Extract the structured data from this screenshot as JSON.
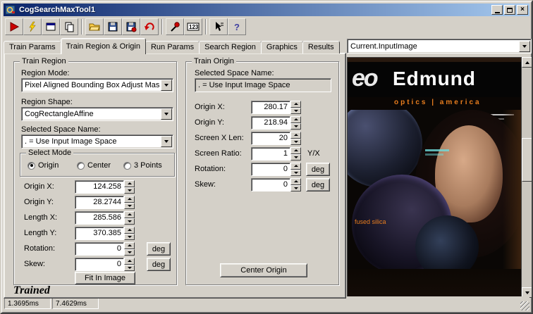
{
  "window": {
    "title": "CogSearchMaxTool1"
  },
  "toolbar": {
    "buttons": [
      {
        "name": "run",
        "icon": "run-icon"
      },
      {
        "name": "auto-run",
        "icon": "lightning-icon"
      },
      {
        "name": "tool-window",
        "icon": "window-icon"
      },
      {
        "name": "copy-window",
        "icon": "copy-icon"
      },
      {
        "name": "open-file",
        "icon": "open-folder-icon"
      },
      {
        "name": "save-file",
        "icon": "save-icon"
      },
      {
        "name": "save-image",
        "icon": "save-image-icon"
      },
      {
        "name": "reset",
        "icon": "undo-icon"
      },
      {
        "name": "probe",
        "icon": "probe-icon"
      },
      {
        "name": "numeric-display",
        "icon": "numeric-123-icon"
      },
      {
        "name": "pointer-info",
        "icon": "pointer-icon"
      },
      {
        "name": "help",
        "icon": "help-icon"
      }
    ]
  },
  "tabs": {
    "active_index": 1,
    "items": [
      {
        "label": "Train Params"
      },
      {
        "label": "Train Region & Origin"
      },
      {
        "label": "Run Params"
      },
      {
        "label": "Search Region"
      },
      {
        "label": "Graphics"
      },
      {
        "label": "Results"
      }
    ]
  },
  "image_selector": {
    "value": "Current.InputImage"
  },
  "train_region": {
    "title": "Train Region",
    "region_mode_label": "Region Mode:",
    "region_mode_value": "Pixel Aligned Bounding Box Adjust Mask",
    "region_shape_label": "Region Shape:",
    "region_shape_value": "CogRectangleAffine",
    "space_label": "Selected Space Name:",
    "space_value": ". = Use Input Image Space",
    "select_mode": {
      "title": "Select Mode",
      "options": [
        {
          "label": "Origin",
          "selected": true
        },
        {
          "label": "Center",
          "selected": false
        },
        {
          "label": "3 Points",
          "selected": false
        }
      ]
    },
    "fields": [
      {
        "label": "Origin X:",
        "value": "124.258"
      },
      {
        "label": "Origin Y:",
        "value": "28.2744"
      },
      {
        "label": "Length X:",
        "value": "285.586"
      },
      {
        "label": "Length Y:",
        "value": "370.385"
      },
      {
        "label": "Rotation:",
        "value": "0",
        "unit": "deg"
      },
      {
        "label": "Skew:",
        "value": "0",
        "unit": "deg"
      }
    ],
    "fit_button_label": "Fit In Image"
  },
  "train_origin": {
    "title": "Train Origin",
    "space_label": "Selected Space Name:",
    "space_value": ". = Use Input Image Space",
    "fields": [
      {
        "label": "Origin X:",
        "value": "280.17"
      },
      {
        "label": "Origin Y:",
        "value": "218.94"
      },
      {
        "label": "Screen X Len:",
        "value": "20"
      },
      {
        "label": "Screen Ratio:",
        "value": "1",
        "unit": "Y/X"
      },
      {
        "label": "Rotation:",
        "value": "0",
        "unit": "deg"
      },
      {
        "label": "Skew:",
        "value": "0",
        "unit": "deg"
      }
    ],
    "center_button_label": "Center Origin"
  },
  "trained_label": "Trained",
  "status_bar": {
    "cells": [
      {
        "text": "1.3695ms"
      },
      {
        "text": "7.4629ms"
      }
    ]
  },
  "preview": {
    "logo_eo": "eo",
    "logo_edmund": "Edmund",
    "tagline": "optics | america",
    "caption": "fused silica"
  },
  "colors": {
    "titlebar_left": "#0a246a",
    "titlebar_right": "#a6caf0",
    "window_bg": "#d4d0c8",
    "accent_orange": "#e87d1e"
  }
}
